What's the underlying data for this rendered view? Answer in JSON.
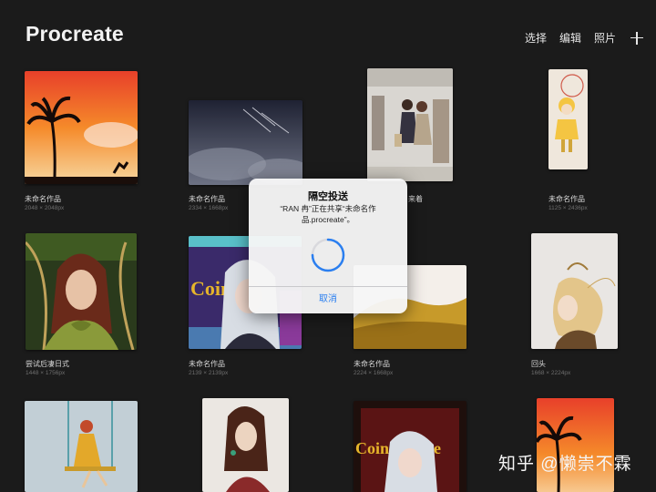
{
  "app": {
    "title": "Procreate"
  },
  "toolbar": {
    "select_label": "选择",
    "edit_label": "编辑",
    "photos_label": "照片",
    "add_icon": "plus-icon"
  },
  "gallery": {
    "items": [
      {
        "name": "未命名作品",
        "size": "2048 × 2048px"
      },
      {
        "name": "未命名作品",
        "size": "2334 × 1668px"
      },
      {
        "name": "来着",
        "size": ""
      },
      {
        "name": "未命名作品",
        "size": "1125 × 2436px"
      },
      {
        "name": "尝试后凄日式",
        "size": "1448 × 1756px"
      },
      {
        "name": "未命名作品",
        "size": "2139 × 2139px"
      },
      {
        "name": "未命名作品",
        "size": "2224 × 1668px"
      },
      {
        "name": "回头",
        "size": "1668 × 2224px"
      },
      {
        "name": "",
        "size": ""
      },
      {
        "name": "",
        "size": ""
      },
      {
        "name": "",
        "size": ""
      },
      {
        "name": "",
        "size": ""
      }
    ]
  },
  "artwork_text": {
    "coin_text": "Coin",
    "coin_text2": "Coincidence"
  },
  "dialog": {
    "title": "隔空投送",
    "message": "“RAN 冉”正在共享“未命名作品.procreate”。",
    "cancel_label": "取消"
  },
  "watermark": {
    "text": "知乎 @懒崇不霖"
  },
  "colors": {
    "background": "#1b1b1b",
    "accent": "#2b7ff0"
  }
}
